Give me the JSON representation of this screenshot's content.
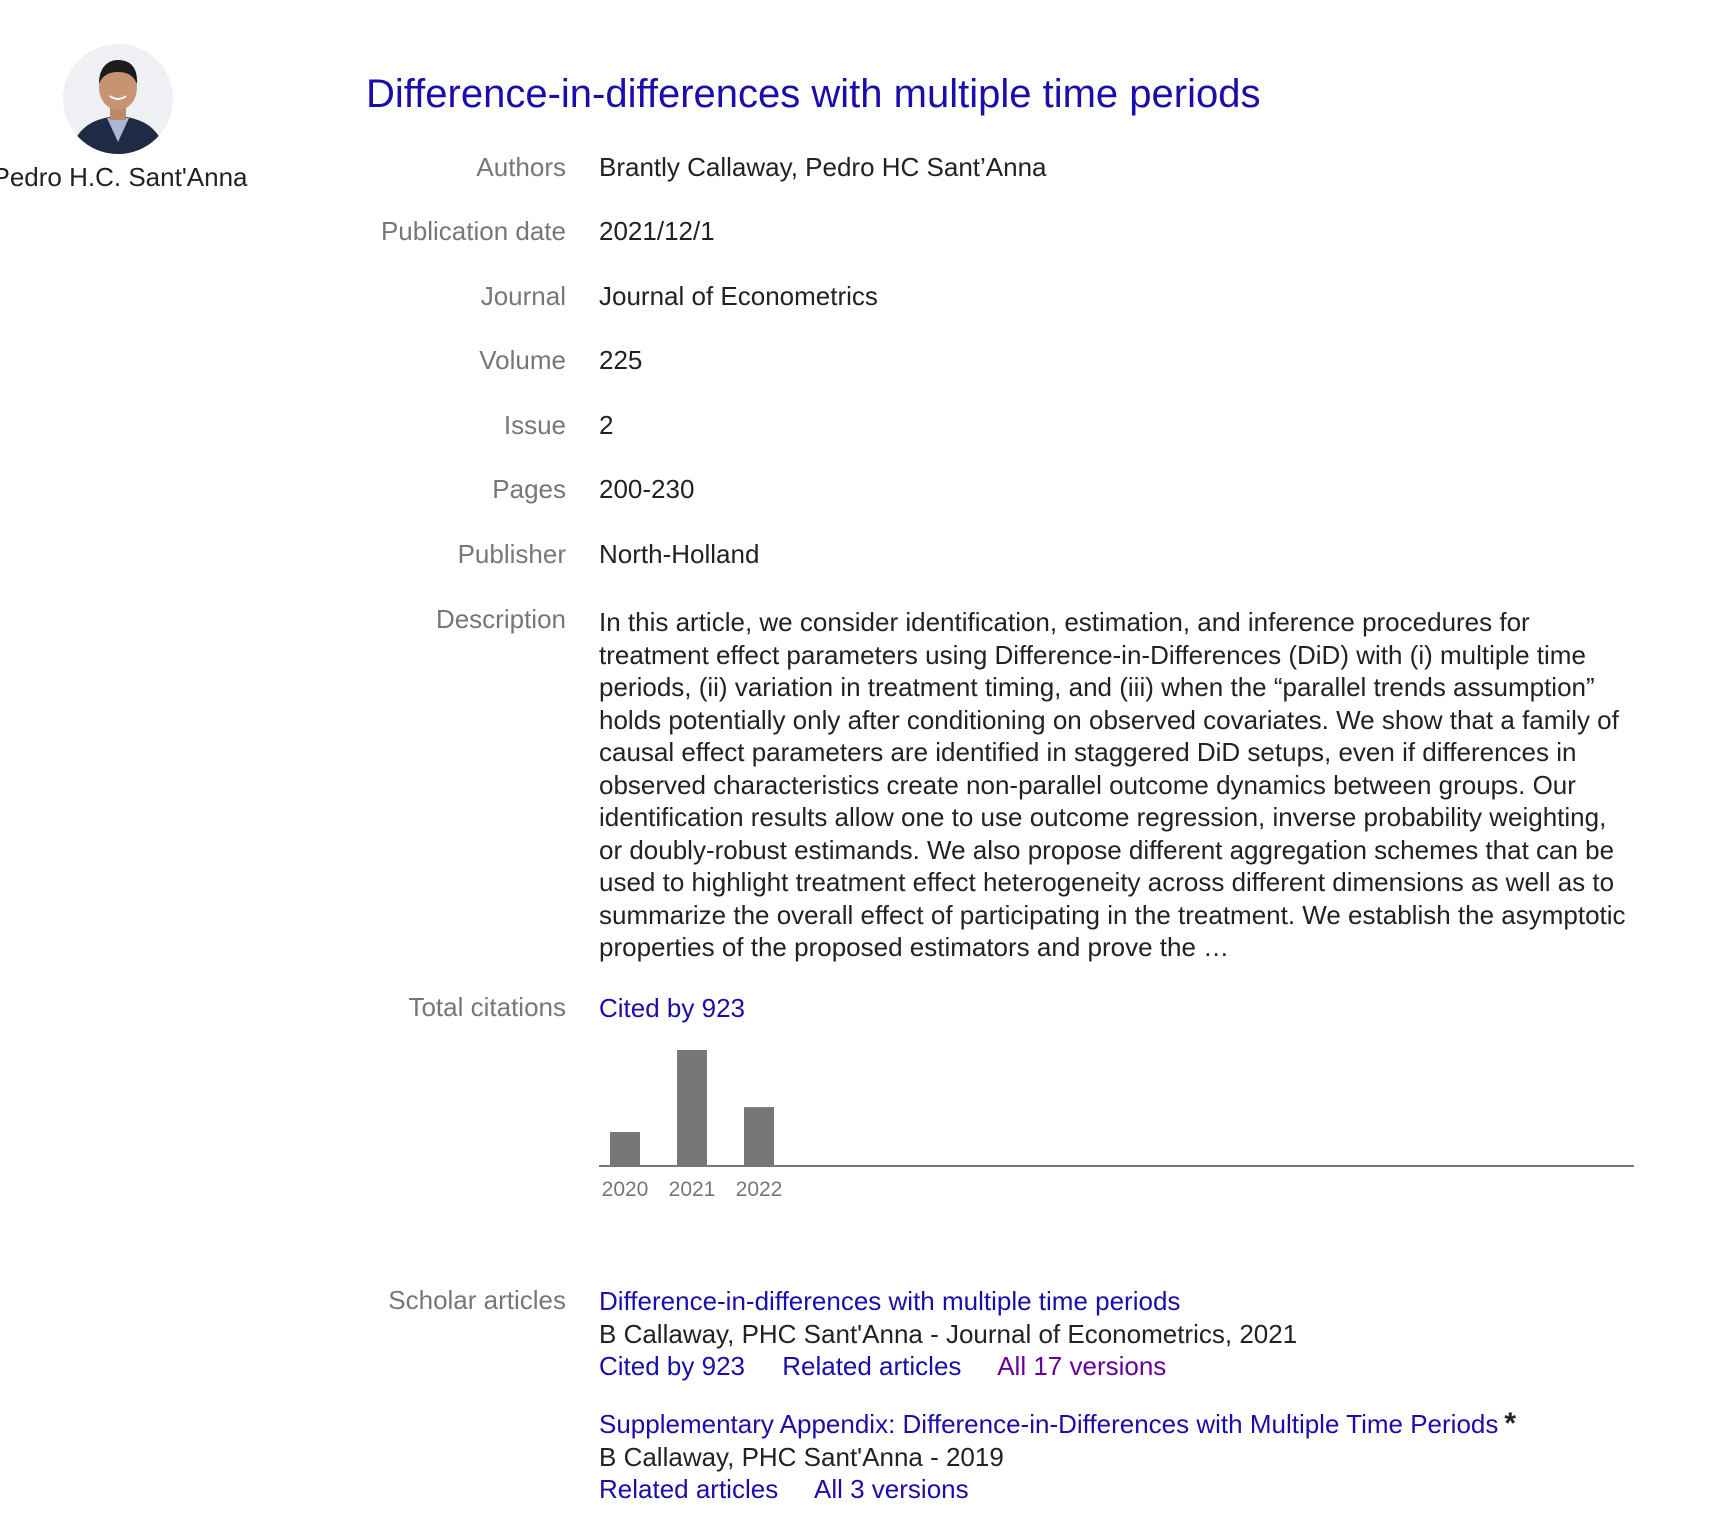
{
  "profile": {
    "name": "Pedro H.C. Sant'Anna",
    "avatar_icon": "person-photo"
  },
  "article": {
    "title": "Difference-in-differences with multiple time periods",
    "fields": {
      "authors_label": "Authors",
      "authors": "Brantly Callaway, Pedro HC Sant’Anna",
      "date_label": "Publication date",
      "date": "2021/12/1",
      "journal_label": "Journal",
      "journal": "Journal of Econometrics",
      "volume_label": "Volume",
      "volume": "225",
      "issue_label": "Issue",
      "issue": "2",
      "pages_label": "Pages",
      "pages": "200-230",
      "publisher_label": "Publisher",
      "publisher": "North-Holland",
      "description_label": "Description",
      "description": "In this article, we consider identification, estimation, and inference procedures for treatment effect parameters using Difference-in-Differences (DiD) with (i) multiple time periods, (ii) variation in treatment timing, and (iii) when the “parallel trends assumption” holds potentially only after conditioning on observed covariates. We show that a family of causal effect parameters are identified in staggered DiD setups, even if differences in observed characteristics create non-parallel outcome dynamics between groups. Our identification results allow one to use outcome regression, inverse probability weighting, or doubly-robust estimands. We also propose different aggregation schemes that can be used to highlight treatment effect heterogeneity across different dimensions as well as to summarize the overall effect of participating in the treatment. We establish the asymptotic properties of the proposed estimators and prove the …",
      "citations_label": "Total citations",
      "cited_by": "Cited by 923",
      "scholar_label": "Scholar articles"
    }
  },
  "chart_data": {
    "type": "bar",
    "categories": [
      "2020",
      "2021",
      "2022"
    ],
    "values": [
      135,
      461,
      234
    ],
    "bar_color": "#777777",
    "axis_color": "#777777"
  },
  "scholar_articles": [
    {
      "title": "Difference-in-differences with multiple time periods",
      "meta": "B Callaway, PHC Sant'Anna - Journal of Econometrics, 2021",
      "cited_by": "Cited by 923",
      "related": "Related articles",
      "versions": "All 17 versions"
    },
    {
      "title": "Supplementary Appendix: Difference-in-Differences with Multiple Time Periods",
      "star": "*",
      "meta": "B Callaway, PHC Sant'Anna - 2019",
      "related": "Related articles",
      "versions": "All 3 versions"
    }
  ],
  "colors": {
    "link": "#1a0dab",
    "visited": "#660099",
    "label": "#777777",
    "text": "#222222"
  }
}
